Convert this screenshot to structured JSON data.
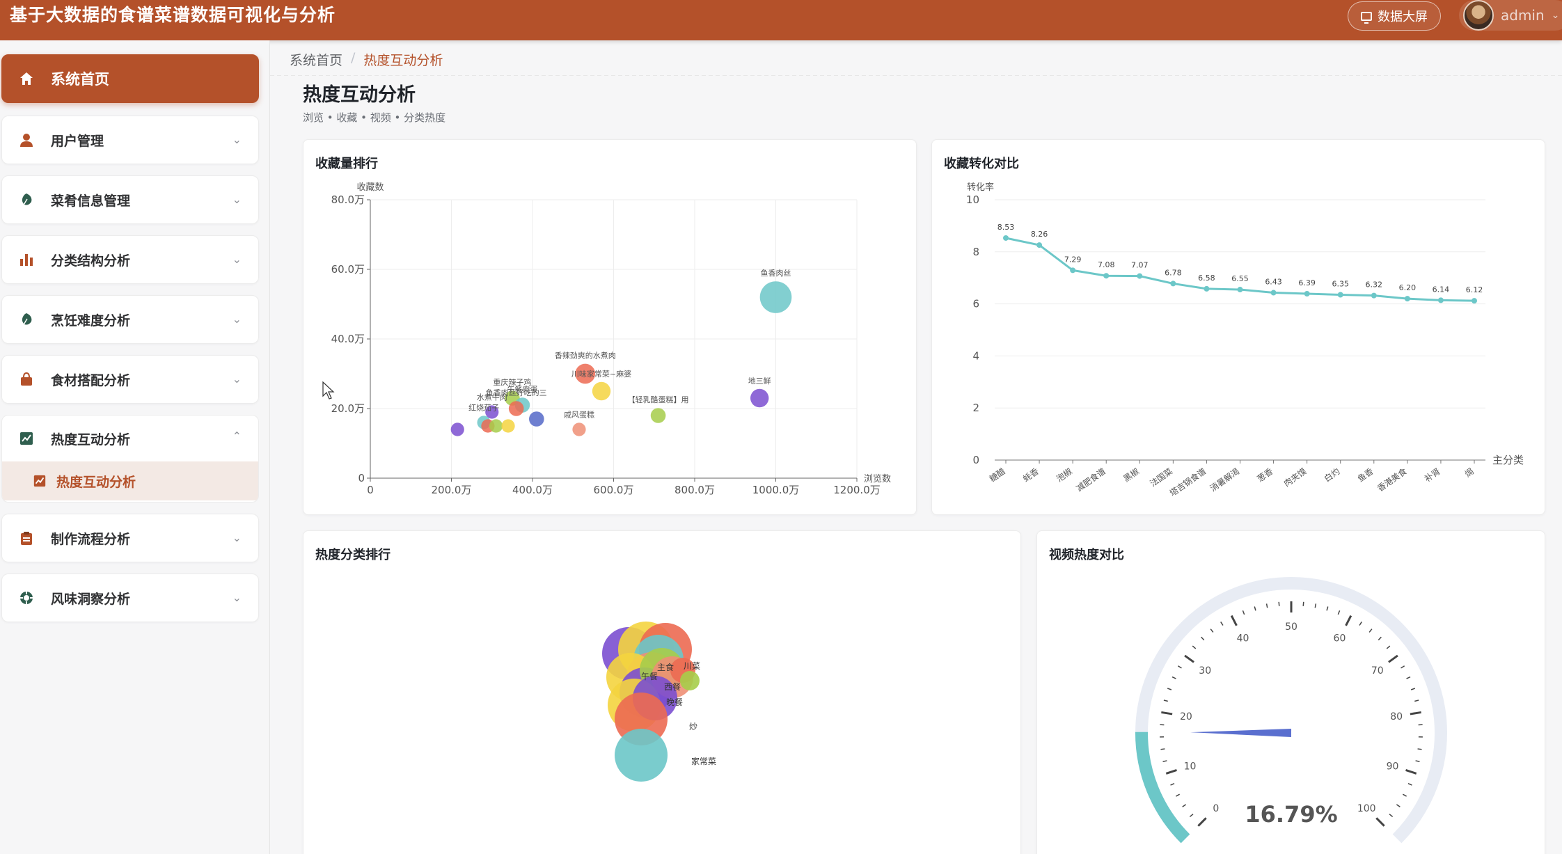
{
  "header": {
    "title": "基于大数据的食谱菜谱数据可视化与分析",
    "screen_button": "数据大屏",
    "user_name": "admin"
  },
  "sidebar": {
    "items": [
      {
        "label": "系统首页",
        "icon": "home-icon"
      },
      {
        "label": "用户管理",
        "icon": "user-icon"
      },
      {
        "label": "菜肴信息管理",
        "icon": "leaf-icon"
      },
      {
        "label": "分类结构分析",
        "icon": "bar-chart-icon"
      },
      {
        "label": "烹饪难度分析",
        "icon": "leaf-icon"
      },
      {
        "label": "食材搭配分析",
        "icon": "bag-icon"
      },
      {
        "label": "热度互动分析",
        "icon": "trend-icon"
      },
      {
        "label": "制作流程分析",
        "icon": "clipboard-icon"
      },
      {
        "label": "风味洞察分析",
        "icon": "compass-icon"
      }
    ],
    "active_sub": "热度互动分析"
  },
  "breadcrumb": {
    "home": "系统首页",
    "current": "热度互动分析"
  },
  "page": {
    "title": "热度互动分析",
    "subtitle": "浏览 • 收藏 • 视频 • 分类热度"
  },
  "cards": {
    "scatter_title": "收藏量排行",
    "line_title": "收藏转化对比",
    "bubble_title": "热度分类排行",
    "gauge_title": "视频热度对比"
  },
  "chart_data": [
    {
      "type": "scatter",
      "xlabel": "浏览数",
      "ylabel": "收藏数",
      "xlim": [
        0,
        1200
      ],
      "ylim": [
        0,
        80
      ],
      "x_ticks": [
        "0",
        "200.0万",
        "400.0万",
        "600.0万",
        "800.0万",
        "1000.0万",
        "1200.0万"
      ],
      "y_ticks": [
        "0",
        "20.0万",
        "40.0万",
        "60.0万",
        "80.0万"
      ],
      "points": [
        {
          "x": 1000,
          "y": 52,
          "r": 19,
          "color": "#6cc7c8",
          "label": "鱼香肉丝"
        },
        {
          "x": 530,
          "y": 30,
          "r": 12,
          "color": "#ec6a52",
          "label": "香辣劲爽的水煮肉"
        },
        {
          "x": 570,
          "y": 25,
          "r": 11,
          "color": "#f4d43f",
          "label": "川味家常菜~麻婆"
        },
        {
          "x": 960,
          "y": 23,
          "r": 11,
          "color": "#7b4fd0",
          "label": "地三鲜"
        },
        {
          "x": 710,
          "y": 18,
          "r": 9,
          "color": "#a6cd4a",
          "label": "【轻乳酪蛋糕】用"
        },
        {
          "x": 515,
          "y": 14,
          "r": 8,
          "color": "#ee8f76",
          "label": "戚风蛋糕"
        },
        {
          "x": 410,
          "y": 17,
          "r": 9,
          "color": "#5568c8",
          "label": ""
        },
        {
          "x": 350,
          "y": 23,
          "r": 9,
          "color": "#a6cd4a",
          "label": "重庆辣子鸡"
        },
        {
          "x": 375,
          "y": 21,
          "r": 9,
          "color": "#6cc7c8",
          "label": "午餐肉蛋"
        },
        {
          "x": 360,
          "y": 20,
          "r": 9,
          "color": "#ec6a52",
          "label": "鱼香肉丝好吃的三"
        },
        {
          "x": 300,
          "y": 19,
          "r": 8,
          "color": "#7b4fd0",
          "label": "水煮牛肉"
        },
        {
          "x": 280,
          "y": 16,
          "r": 8,
          "color": "#6cc7c8",
          "label": "红烧茄子"
        },
        {
          "x": 290,
          "y": 15,
          "r": 8,
          "color": "#ec6a52",
          "label": ""
        },
        {
          "x": 310,
          "y": 15,
          "r": 8,
          "color": "#a6cd4a",
          "label": ""
        },
        {
          "x": 340,
          "y": 15,
          "r": 8,
          "color": "#f4d43f",
          "label": ""
        },
        {
          "x": 215,
          "y": 14,
          "r": 8,
          "color": "#7b4fd0",
          "label": ""
        }
      ]
    },
    {
      "type": "line",
      "ylabel": "转化率",
      "xlabel": "主分类",
      "ylim": [
        0,
        10
      ],
      "y_ticks": [
        "0",
        "2",
        "4",
        "6",
        "8",
        "10"
      ],
      "categories": [
        "糖醋",
        "蚝香",
        "泡椒",
        "减肥食谱",
        "黑椒",
        "法国菜",
        "塔吉锅食谱",
        "消暑解渴",
        "葱香",
        "肉夹馍",
        "白灼",
        "鱼香",
        "香港美食",
        "补肾",
        "焗"
      ],
      "values": [
        8.53,
        8.26,
        7.29,
        7.08,
        7.07,
        6.78,
        6.58,
        6.55,
        6.43,
        6.39,
        6.35,
        6.32,
        6.2,
        6.14,
        6.12
      ],
      "color": "#6cc7c8"
    },
    {
      "type": "bubble",
      "labels": [
        "主食",
        "川菜",
        "午餐",
        "炒",
        "家常菜",
        "晚餐",
        "西餐"
      ],
      "colors": [
        "#ec6a52",
        "#f4d43f",
        "#7b4fd0",
        "#6cc7c8",
        "#ee8f76",
        "#a6cd4a"
      ]
    },
    {
      "type": "gauge",
      "min": 0,
      "max": 100,
      "value": 16.79,
      "value_text": "16.79%",
      "ticks": [
        "0",
        "10",
        "20",
        "30",
        "40",
        "50",
        "60",
        "70",
        "80",
        "90",
        "100"
      ],
      "color": "#6cc7c8",
      "pointer_color": "#5a6fcf"
    }
  ]
}
